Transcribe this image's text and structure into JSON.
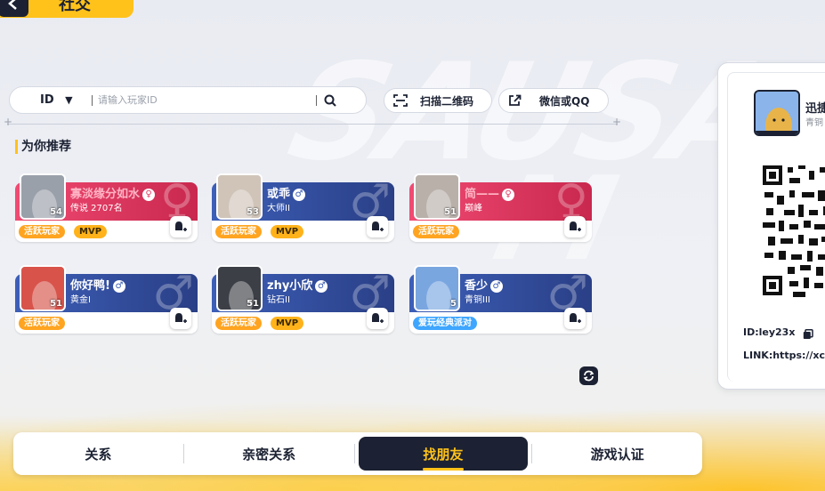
{
  "header": {
    "title": "社交"
  },
  "search": {
    "type_label": "ID",
    "placeholder": "请输入玩家ID",
    "scan_label": "扫描二维码",
    "share_label": "微信或QQ"
  },
  "section_title": "为你推荐",
  "recommend": [
    {
      "name": "寡淡缘分如水",
      "gender": "♀",
      "rank": "传说 2707名",
      "level": "54",
      "theme": "pink",
      "tags": [
        "活跃玩家",
        "MVP"
      ]
    },
    {
      "name": "或乖",
      "gender": "♂",
      "rank": "大师II",
      "level": "53",
      "theme": "blue",
      "tags": [
        "活跃玩家",
        "MVP"
      ]
    },
    {
      "name": "简——",
      "gender": "♀",
      "rank": "巅峰",
      "level": "51",
      "theme": "pink",
      "tags": [
        "活跃玩家"
      ]
    },
    {
      "name": "你好鸭!",
      "gender": "♂",
      "rank": "黄金I",
      "level": "51",
      "theme": "blue",
      "tags": [
        "活跃玩家"
      ]
    },
    {
      "name": "zhy小欣",
      "gender": "♂",
      "rank": "钻石II",
      "level": "51",
      "theme": "blue",
      "tags": [
        "活跃玩家",
        "MVP"
      ]
    },
    {
      "name": "香少",
      "gender": "♂",
      "rank": "青铜III",
      "level": "5",
      "theme": "blue",
      "tags": [
        "爱玩经典派对"
      ]
    }
  ],
  "tabs": [
    {
      "label": "关系",
      "active": false
    },
    {
      "label": "亲密关系",
      "active": false
    },
    {
      "label": "找朋友",
      "active": true
    },
    {
      "label": "游戏认证",
      "active": false
    }
  ],
  "profile_card": {
    "name": "迅捷",
    "rank": "青铜",
    "id_text": "ID:ley23x",
    "link_text": "LINK:https://xc.xc"
  },
  "background_text": {
    "line1": "SAUSA",
    "line2": "M"
  },
  "colors": {
    "accent": "#ffc21a",
    "dark": "#1c2233",
    "pink": "#e43a63",
    "blue": "#3d5fb8"
  }
}
